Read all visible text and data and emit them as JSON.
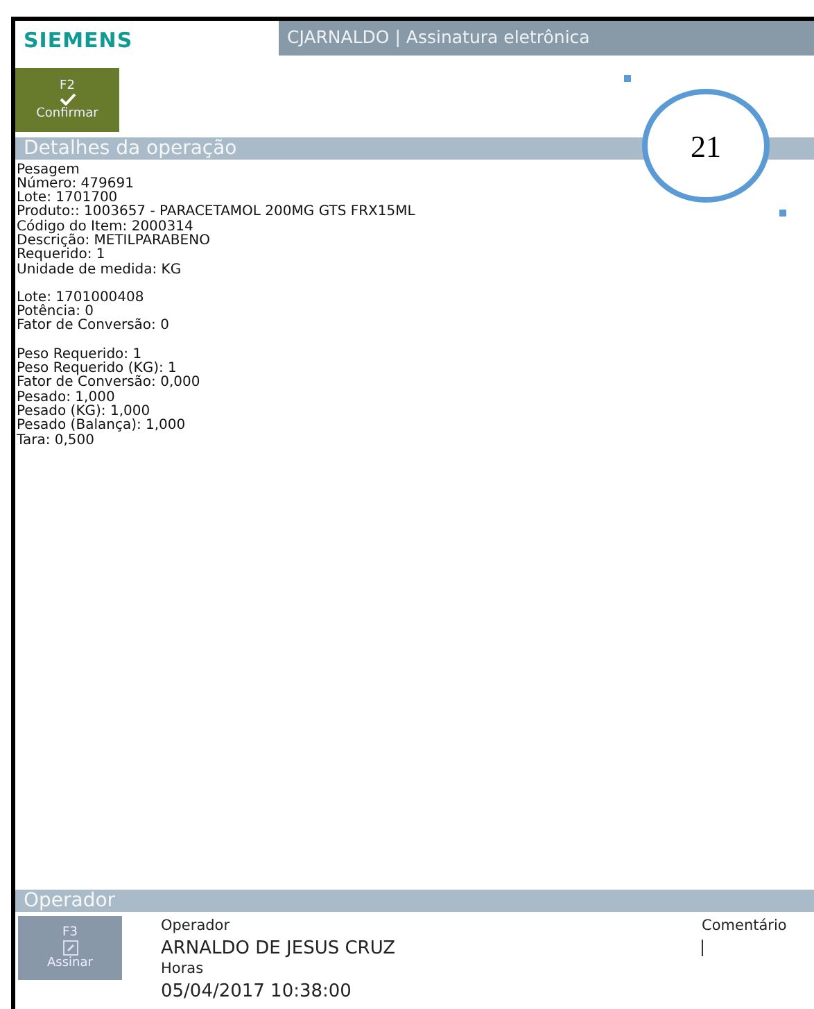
{
  "header": {
    "logo": "SIEMENS",
    "title": "CJARNALDO | Assinatura eletrônica"
  },
  "confirm_button": {
    "key": "F2",
    "label": "Confirmar"
  },
  "callout": {
    "text": "21"
  },
  "details": {
    "title": "Detalhes da operação",
    "groups": [
      [
        "Pesagem",
        "Número: 479691",
        "Lote: 1701700",
        "Produto:: 1003657 - PARACETAMOL 200MG GTS FRX15ML",
        "Código do Item: 2000314",
        "Descrição: METILPARABENO",
        "Requerido: 1",
        "Unidade de medida: KG"
      ],
      [
        "Lote: 1701000408",
        "Potência: 0",
        "Fator de Conversão: 0"
      ],
      [
        "Peso Requerido: 1",
        "Peso Requerido (KG): 1",
        "Fator de Conversão: 0,000",
        "Pesado: 1,000",
        "Pesado (KG): 1,000",
        "Pesado (Balança): 1,000",
        "Tara: 0,500"
      ]
    ]
  },
  "operator": {
    "title": "Operador",
    "sign_button": {
      "key": "F3",
      "label": "Assinar"
    },
    "fields": [
      {
        "label": "Operador",
        "value": "ARNALDO DE JESUS CRUZ"
      },
      {
        "label": "Horas",
        "value": "05/04/2017 10:38:00"
      }
    ],
    "comment": {
      "label": "Comentário"
    }
  }
}
